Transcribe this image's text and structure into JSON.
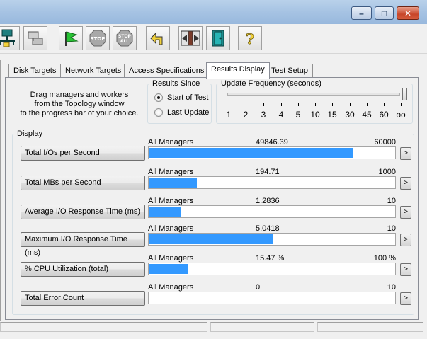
{
  "window": {
    "controls": {
      "minimize": "–",
      "maximize": "□",
      "close": "✕"
    }
  },
  "toolbar": {
    "buttons": [
      {
        "name": "topology-icon"
      },
      {
        "name": "disk-workers-icon"
      },
      {
        "name": "start-tests-icon"
      },
      {
        "name": "stop-icon",
        "label": "STOP"
      },
      {
        "name": "stop-all-icon",
        "label_top": "STOP",
        "label_bottom": "ALL"
      },
      {
        "name": "reset-icon"
      },
      {
        "name": "exit-icon"
      },
      {
        "name": "exit-save-icon"
      },
      {
        "name": "help-icon",
        "label": "?"
      }
    ]
  },
  "tabs": [
    {
      "label": "Disk Targets",
      "active": false
    },
    {
      "label": "Network Targets",
      "active": false
    },
    {
      "label": "Access Specifications",
      "active": false
    },
    {
      "label": "Results Display",
      "active": true
    },
    {
      "label": "Test Setup",
      "active": false
    }
  ],
  "instructions": {
    "line1": "Drag managers and workers",
    "line2": "from the Topology window",
    "line3": "to the progress bar of your choice."
  },
  "results_since": {
    "title": "Results Since",
    "options": [
      {
        "label": "Start of Test",
        "selected": true
      },
      {
        "label": "Last Update",
        "selected": false
      }
    ]
  },
  "update_frequency": {
    "title": "Update Frequency (seconds)",
    "ticks": [
      "1",
      "2",
      "3",
      "4",
      "5",
      "10",
      "15",
      "30",
      "45",
      "60",
      "oo"
    ],
    "selected": "oo"
  },
  "display": {
    "title": "Display",
    "rows": [
      {
        "metric": "Total I/Os per Second",
        "source": "All Managers",
        "value": "49846.39",
        "max": "60000",
        "fraction": 0.831
      },
      {
        "metric": "Total MBs per Second",
        "source": "All Managers",
        "value": "194.71",
        "max": "1000",
        "fraction": 0.195
      },
      {
        "metric": "Average I/O Response Time (ms)",
        "source": "All Managers",
        "value": "1.2836",
        "max": "10",
        "fraction": 0.128
      },
      {
        "metric": "Maximum I/O Response Time (ms)",
        "source": "All Managers",
        "value": "5.0418",
        "max": "10",
        "fraction": 0.504
      },
      {
        "metric": "% CPU Utilization (total)",
        "source": "All Managers",
        "value": "15.47 %",
        "max": "100 %",
        "fraction": 0.155
      },
      {
        "metric": "Total Error Count",
        "source": "All Managers",
        "value": "0",
        "max": "10",
        "fraction": 0
      }
    ],
    "expand_label": ">"
  },
  "colors": {
    "bar": "#3399ff"
  }
}
